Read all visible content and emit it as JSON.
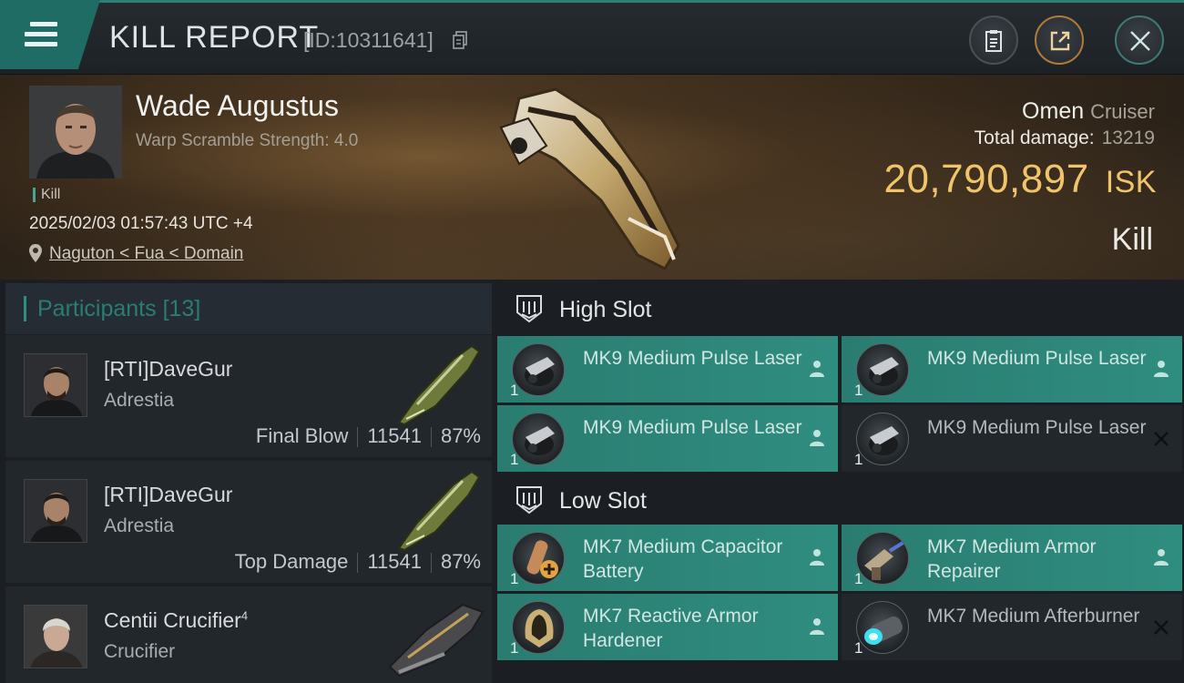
{
  "header": {
    "title": "KILL REPORT",
    "kill_id": "[ID:10311641]"
  },
  "victim": {
    "name": "Wade Augustus",
    "warp_scramble": "Warp Scramble Strength: 4.0",
    "tag": "Kill",
    "timestamp": "2025/02/03 01:57:43 UTC +4",
    "location": "Naguton < Fua < Domain",
    "ship_name": "Omen",
    "ship_class": "Cruiser",
    "total_damage_label": "Total damage:",
    "total_damage_value": "13219",
    "isk_value": "20,790,897",
    "isk_unit": "ISK",
    "kill_type": "Kill"
  },
  "participants": {
    "title": "Participants",
    "count": "[13]",
    "rows": [
      {
        "name": "[RTI]DaveGur",
        "sup": "",
        "ship": "Adrestia",
        "role": "Final Blow",
        "damage": "11541",
        "percent": "87%"
      },
      {
        "name": "[RTI]DaveGur",
        "sup": "",
        "ship": "Adrestia",
        "role": "Top Damage",
        "damage": "11541",
        "percent": "87%"
      },
      {
        "name": "Centii Crucifier",
        "sup": "4",
        "ship": "Crucifier",
        "role": "",
        "damage": "",
        "percent": ""
      }
    ]
  },
  "fitting": {
    "high_slot_label": "High Slot",
    "low_slot_label": "Low Slot",
    "high": [
      {
        "name": "MK9 Medium Pulse Laser",
        "qty": "1",
        "state": "active"
      },
      {
        "name": "MK9 Medium Pulse Laser",
        "qty": "1",
        "state": "active"
      },
      {
        "name": "MK9 Medium Pulse Laser",
        "qty": "1",
        "state": "active"
      },
      {
        "name": "MK9 Medium Pulse Laser",
        "qty": "1",
        "state": "destroyed"
      }
    ],
    "low": [
      {
        "name": "MK7 Medium Capacitor Battery",
        "qty": "1",
        "state": "active"
      },
      {
        "name": "MK7 Medium Armor Repairer",
        "qty": "1",
        "state": "active"
      },
      {
        "name": "MK7 Reactive Armor Hardener",
        "qty": "1",
        "state": "active"
      },
      {
        "name": "MK7 Medium Afterburner",
        "qty": "1",
        "state": "destroyed"
      }
    ]
  },
  "colors": {
    "accent_teal": "#2f8d80",
    "isk_gold": "#f0c56a",
    "background": "#1b1f23"
  },
  "icons": [
    "menu-icon",
    "copy-icon",
    "clipboard-icon",
    "share-icon",
    "close-icon",
    "location-pin-icon",
    "high-slot-icon",
    "low-slot-icon",
    "user-icon",
    "x-icon"
  ]
}
